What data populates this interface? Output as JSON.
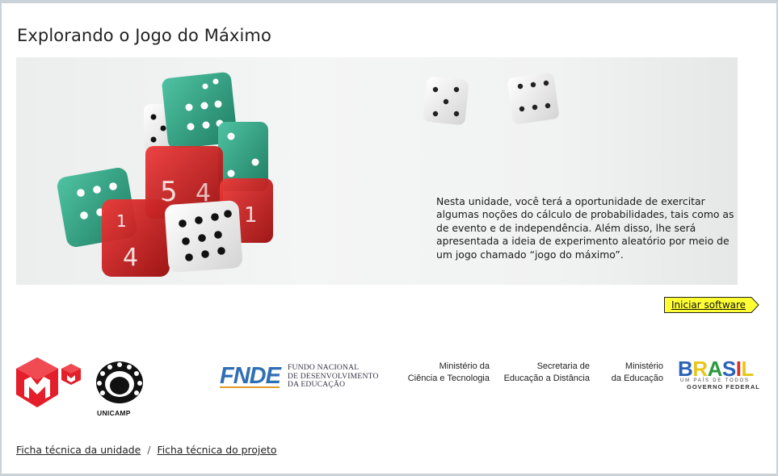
{
  "page": {
    "title": "Explorando o Jogo do Máximo"
  },
  "hero": {
    "description": "Nesta unidade, você terá a oportunidade de exercitar algumas noções do cálculo de probabilidades, tais como as de evento e de independência. Além disso, lhe será apresentada a ideia de experimento aleatório por meio de um jogo chamado “jogo do máximo”.",
    "image": "dice-photo",
    "colors": {
      "green_dice": "#2f9e80",
      "red_dice": "#c81818",
      "white_dice": "#f6f6f6"
    }
  },
  "actions": {
    "start_label": "Iniciar software",
    "start_bg": "#ffff33"
  },
  "partners": {
    "m3_logo": "m3-logo",
    "unicamp": "UNICAMP",
    "fnde_mark": "FNDE",
    "fnde_lines": [
      "FUNDO NACIONAL",
      "DE DESENVOLVIMENTO",
      "DA EDUCAÇÃO"
    ],
    "mct_lines": [
      "Ministério da",
      "Ciência e Tecnologia"
    ],
    "seed_lines": [
      "Secretaria de",
      "Educação a Distância"
    ],
    "mec_lines": [
      "Ministério",
      "da Educação"
    ],
    "brasil": "BRASIL",
    "brasil_tagline": "UM PAÍS DE TODOS",
    "brasil_sub": "GOVERNO FEDERAL"
  },
  "footer": {
    "link_unit": "Ficha técnica da unidade",
    "separator": "/",
    "link_project": "Ficha técnica do projeto"
  }
}
